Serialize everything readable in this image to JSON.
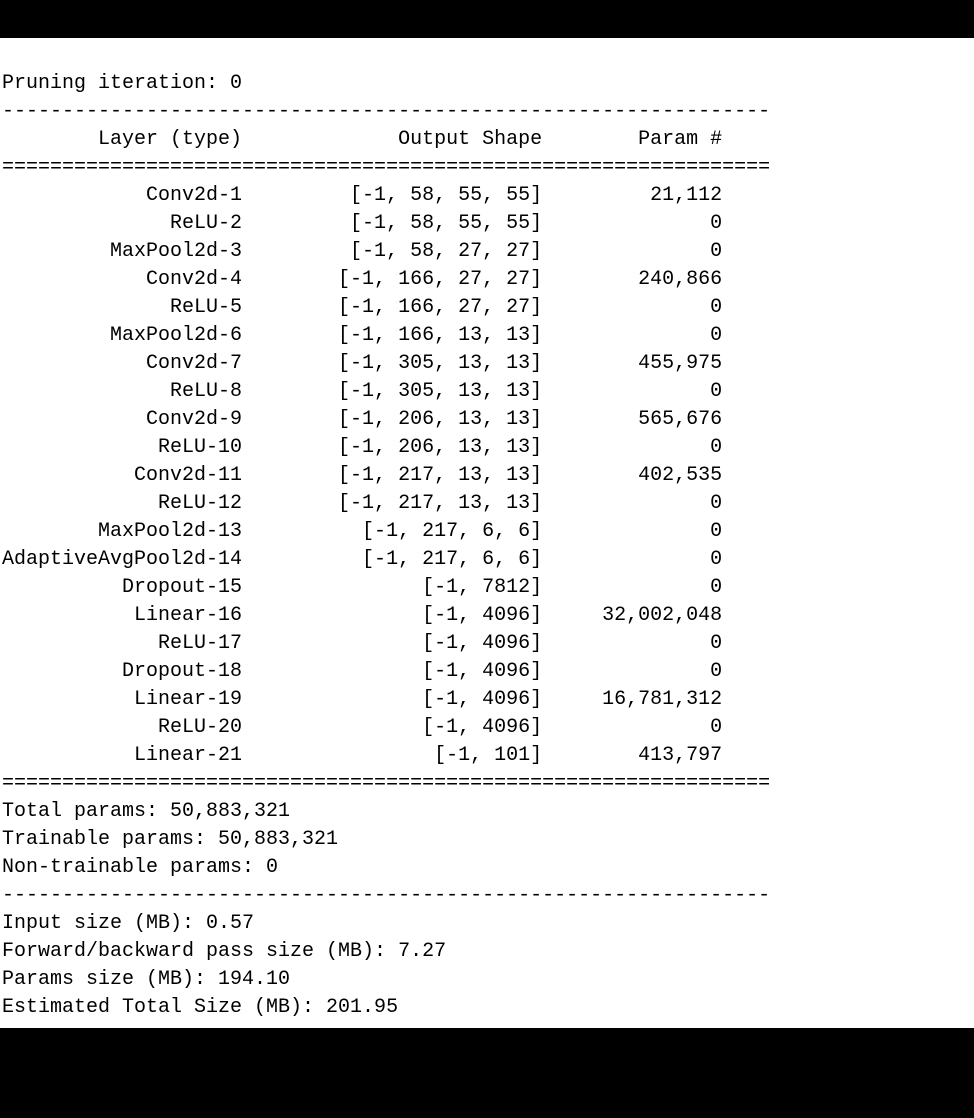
{
  "header": {
    "title": "Pruning iteration: 0"
  },
  "table_headers": {
    "layer": "Layer (type)",
    "output_shape": "Output Shape",
    "params": "Param #"
  },
  "layers": [
    {
      "name": "Conv2d-1",
      "shape": "[-1, 58, 55, 55]",
      "params": "21,112"
    },
    {
      "name": "ReLU-2",
      "shape": "[-1, 58, 55, 55]",
      "params": "0"
    },
    {
      "name": "MaxPool2d-3",
      "shape": "[-1, 58, 27, 27]",
      "params": "0"
    },
    {
      "name": "Conv2d-4",
      "shape": "[-1, 166, 27, 27]",
      "params": "240,866"
    },
    {
      "name": "ReLU-5",
      "shape": "[-1, 166, 27, 27]",
      "params": "0"
    },
    {
      "name": "MaxPool2d-6",
      "shape": "[-1, 166, 13, 13]",
      "params": "0"
    },
    {
      "name": "Conv2d-7",
      "shape": "[-1, 305, 13, 13]",
      "params": "455,975"
    },
    {
      "name": "ReLU-8",
      "shape": "[-1, 305, 13, 13]",
      "params": "0"
    },
    {
      "name": "Conv2d-9",
      "shape": "[-1, 206, 13, 13]",
      "params": "565,676"
    },
    {
      "name": "ReLU-10",
      "shape": "[-1, 206, 13, 13]",
      "params": "0"
    },
    {
      "name": "Conv2d-11",
      "shape": "[-1, 217, 13, 13]",
      "params": "402,535"
    },
    {
      "name": "ReLU-12",
      "shape": "[-1, 217, 13, 13]",
      "params": "0"
    },
    {
      "name": "MaxPool2d-13",
      "shape": "[-1, 217, 6, 6]",
      "params": "0"
    },
    {
      "name": "AdaptiveAvgPool2d-14",
      "shape": "[-1, 217, 6, 6]",
      "params": "0"
    },
    {
      "name": "Dropout-15",
      "shape": "[-1, 7812]",
      "params": "0"
    },
    {
      "name": "Linear-16",
      "shape": "[-1, 4096]",
      "params": "32,002,048"
    },
    {
      "name": "ReLU-17",
      "shape": "[-1, 4096]",
      "params": "0"
    },
    {
      "name": "Dropout-18",
      "shape": "[-1, 4096]",
      "params": "0"
    },
    {
      "name": "Linear-19",
      "shape": "[-1, 4096]",
      "params": "16,781,312"
    },
    {
      "name": "ReLU-20",
      "shape": "[-1, 4096]",
      "params": "0"
    },
    {
      "name": "Linear-21",
      "shape": "[-1, 101]",
      "params": "413,797"
    }
  ],
  "summary": {
    "total_params_label": "Total params:",
    "total_params": "50,883,321",
    "trainable_params_label": "Trainable params:",
    "trainable_params": "50,883,321",
    "non_trainable_params_label": "Non-trainable params:",
    "non_trainable_params": "0",
    "input_size_label": "Input size (MB):",
    "input_size": "0.57",
    "fwd_bwd_size_label": "Forward/backward pass size (MB):",
    "fwd_bwd_size": "7.27",
    "params_size_label": "Params size (MB):",
    "params_size": "194.10",
    "est_total_size_label": "Estimated Total Size (MB):",
    "est_total_size": "201.95"
  },
  "chart_data": {
    "type": "table",
    "title": "Pruning iteration: 0",
    "columns": [
      "Layer (type)",
      "Output Shape",
      "Param #"
    ],
    "rows": [
      [
        "Conv2d-1",
        "[-1, 58, 55, 55]",
        "21,112"
      ],
      [
        "ReLU-2",
        "[-1, 58, 55, 55]",
        "0"
      ],
      [
        "MaxPool2d-3",
        "[-1, 58, 27, 27]",
        "0"
      ],
      [
        "Conv2d-4",
        "[-1, 166, 27, 27]",
        "240,866"
      ],
      [
        "ReLU-5",
        "[-1, 166, 27, 27]",
        "0"
      ],
      [
        "MaxPool2d-6",
        "[-1, 166, 13, 13]",
        "0"
      ],
      [
        "Conv2d-7",
        "[-1, 305, 13, 13]",
        "455,975"
      ],
      [
        "ReLU-8",
        "[-1, 305, 13, 13]",
        "0"
      ],
      [
        "Conv2d-9",
        "[-1, 206, 13, 13]",
        "565,676"
      ],
      [
        "ReLU-10",
        "[-1, 206, 13, 13]",
        "0"
      ],
      [
        "Conv2d-11",
        "[-1, 217, 13, 13]",
        "402,535"
      ],
      [
        "ReLU-12",
        "[-1, 217, 13, 13]",
        "0"
      ],
      [
        "MaxPool2d-13",
        "[-1, 217, 6, 6]",
        "0"
      ],
      [
        "AdaptiveAvgPool2d-14",
        "[-1, 217, 6, 6]",
        "0"
      ],
      [
        "Dropout-15",
        "[-1, 7812]",
        "0"
      ],
      [
        "Linear-16",
        "[-1, 4096]",
        "32,002,048"
      ],
      [
        "ReLU-17",
        "[-1, 4096]",
        "0"
      ],
      [
        "Dropout-18",
        "[-1, 4096]",
        "0"
      ],
      [
        "Linear-19",
        "[-1, 4096]",
        "16,781,312"
      ],
      [
        "ReLU-20",
        "[-1, 4096]",
        "0"
      ],
      [
        "Linear-21",
        "[-1, 101]",
        "413,797"
      ]
    ],
    "footer": {
      "Total params": "50,883,321",
      "Trainable params": "50,883,321",
      "Non-trainable params": "0",
      "Input size (MB)": "0.57",
      "Forward/backward pass size (MB)": "7.27",
      "Params size (MB)": "194.10",
      "Estimated Total Size (MB)": "201.95"
    }
  }
}
